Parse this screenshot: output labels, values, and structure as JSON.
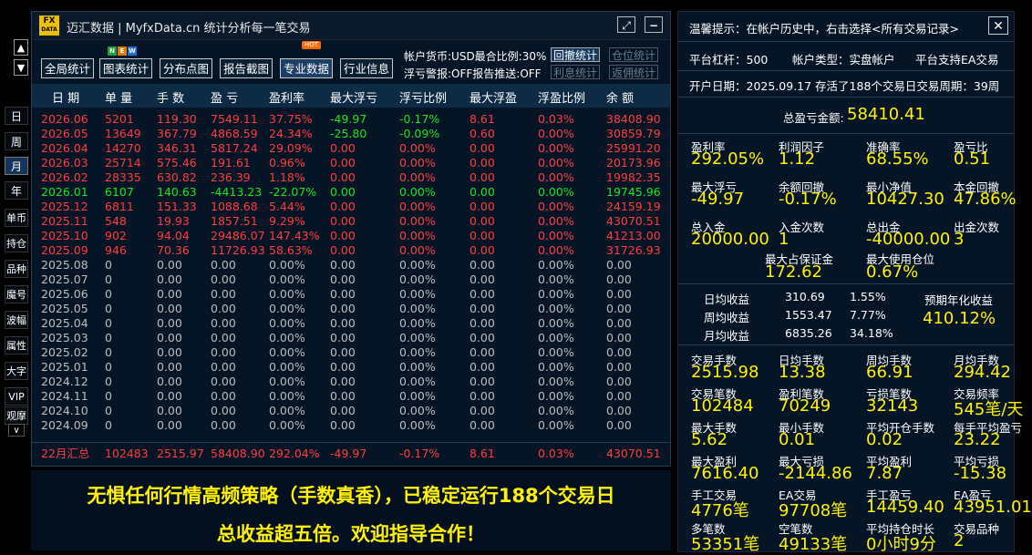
{
  "window": {
    "logo_top": "FX",
    "logo_bottom": "DATA",
    "title": "迈汇数据 | MyfxData.cn  统计分析每一笔交易",
    "minimize_glyph": "−",
    "restore_glyph": "⤢"
  },
  "toolbar": {
    "buttons": [
      "全局统计",
      "图表统计",
      "分布点图",
      "报告截图",
      "专业数据",
      "行业信息"
    ],
    "new_badge": [
      "N",
      "E",
      "W"
    ],
    "hot_badge": "HOT",
    "info1": "帐户货币:USD最合比例:30%",
    "info2": "浮亏警报:OFF报告推送:OFF",
    "btn_withdraw_stats": "回撤统计",
    "btn_position_stats": "仓位统计",
    "btn_interest_stats": "利息统计",
    "btn_commission_stats": "返佣统计",
    "up_arrow": "▲",
    "down_arrow": "▼"
  },
  "left_tabs": [
    "日",
    "周",
    "月",
    "年",
    "单币",
    "持仓",
    "品种",
    "魔号",
    "波幅",
    "属性",
    "大字",
    "VIP",
    "观摩"
  ],
  "left_tabs_more": "∨",
  "table": {
    "headers": [
      "日 期",
      "单 量",
      "手 数",
      "盈 亏",
      "盈利率",
      "最大浮亏",
      "浮亏比例",
      "最大浮盈",
      "浮盈比例",
      "余 额"
    ],
    "rows": [
      [
        "2026.06",
        "5201",
        "119.30",
        "7549.11",
        "37.75%",
        "-49.97",
        "-0.17%",
        "8.61",
        "0.03%",
        "38408.90"
      ],
      [
        "2026.05",
        "13649",
        "367.79",
        "4868.59",
        "24.34%",
        "-25.80",
        "-0.09%",
        "0.60",
        "0.00%",
        "30859.79"
      ],
      [
        "2026.04",
        "14270",
        "346.31",
        "5817.24",
        "29.09%",
        "0.00",
        "0.00%",
        "0.00",
        "0.00%",
        "25991.20"
      ],
      [
        "2026.03",
        "25714",
        "575.46",
        "191.61",
        "0.96%",
        "0.00",
        "0.00%",
        "0.00",
        "0.00%",
        "20173.96"
      ],
      [
        "2026.02",
        "28335",
        "630.82",
        "236.39",
        "1.18%",
        "0.00",
        "0.00%",
        "0.00",
        "0.00%",
        "19982.35"
      ],
      [
        "2026.01",
        "6107",
        "140.63",
        "-4413.23",
        "-22.07%",
        "0.00",
        "0.00%",
        "0.00",
        "0.00%",
        "19745.96"
      ],
      [
        "2025.12",
        "6811",
        "151.33",
        "1088.68",
        "5.44%",
        "0.00",
        "0.00%",
        "0.00",
        "0.00%",
        "24159.19"
      ],
      [
        "2025.11",
        "548",
        "19.93",
        "1857.51",
        "9.29%",
        "0.00",
        "0.00%",
        "0.00",
        "0.00%",
        "43070.51"
      ],
      [
        "2025.10",
        "902",
        "94.04",
        "29486.07",
        "147.43%",
        "0.00",
        "0.00%",
        "0.00",
        "0.00%",
        "41213.00"
      ],
      [
        "2025.09",
        "946",
        "70.36",
        "11726.93",
        "58.63%",
        "0.00",
        "0.00%",
        "0.00",
        "0.00%",
        "31726.93"
      ],
      [
        "2025.08",
        "0",
        "0.00",
        "0.00",
        "0.00%",
        "0.00",
        "0.00%",
        "0.00",
        "0.00%",
        "0.00"
      ],
      [
        "2025.07",
        "0",
        "0.00",
        "0.00",
        "0.00%",
        "0.00",
        "0.00%",
        "0.00",
        "0.00%",
        "0.00"
      ],
      [
        "2025.06",
        "0",
        "0.00",
        "0.00",
        "0.00%",
        "0.00",
        "0.00%",
        "0.00",
        "0.00%",
        "0.00"
      ],
      [
        "2025.05",
        "0",
        "0.00",
        "0.00",
        "0.00%",
        "0.00",
        "0.00%",
        "0.00",
        "0.00%",
        "0.00"
      ],
      [
        "2025.04",
        "0",
        "0.00",
        "0.00",
        "0.00%",
        "0.00",
        "0.00%",
        "0.00",
        "0.00%",
        "0.00"
      ],
      [
        "2025.03",
        "0",
        "0.00",
        "0.00",
        "0.00%",
        "0.00",
        "0.00%",
        "0.00",
        "0.00%",
        "0.00"
      ],
      [
        "2025.02",
        "0",
        "0.00",
        "0.00",
        "0.00%",
        "0.00",
        "0.00%",
        "0.00",
        "0.00%",
        "0.00"
      ],
      [
        "2025.01",
        "0",
        "0.00",
        "0.00",
        "0.00%",
        "0.00",
        "0.00%",
        "0.00",
        "0.00%",
        "0.00"
      ],
      [
        "2024.12",
        "0",
        "0.00",
        "0.00",
        "0.00%",
        "0.00",
        "0.00%",
        "0.00",
        "0.00%",
        "0.00"
      ],
      [
        "2024.11",
        "0",
        "0.00",
        "0.00",
        "0.00%",
        "0.00",
        "0.00%",
        "0.00",
        "0.00%",
        "0.00"
      ],
      [
        "2024.10",
        "0",
        "0.00",
        "0.00",
        "0.00%",
        "0.00",
        "0.00%",
        "0.00",
        "0.00%",
        "0.00"
      ],
      [
        "2024.09",
        "0",
        "0.00",
        "0.00",
        "0.00%",
        "0.00",
        "0.00%",
        "0.00",
        "0.00%",
        "0.00"
      ]
    ],
    "row_colors": [
      "red",
      "red",
      "red",
      "red",
      "red",
      "green",
      "red",
      "red",
      "red",
      "red",
      "gray",
      "gray",
      "gray",
      "gray",
      "gray",
      "gray",
      "gray",
      "gray",
      "gray",
      "gray",
      "gray",
      "gray"
    ],
    "summary": [
      "22月汇总",
      "102483",
      "2515.97",
      "58408.90",
      "292.04%",
      "-49.97",
      "-0.17%",
      "8.61",
      "0.03%",
      "43070.51"
    ]
  },
  "banner": {
    "line1": "无惧任何行情高频策略（手数真香），已稳定运行188个交易日",
    "line2": "总收益超五倍。欢迎指导合作！"
  },
  "right": {
    "tip": "温馨提示：在帐户历史中，右击选择<所有交易记录>",
    "close_glyph": "✕",
    "platform_leverage": "平台杠杆：500",
    "account_type": "帐户类型：实盘帐户",
    "ea_support": "平台支持EA交易",
    "open_info": "开户日期：2025.09.17 存活了188个交易日交易周期：39周",
    "total_pl_label": "总盈亏金额:",
    "total_pl_value": "58410.41",
    "grid1": [
      {
        "label": "盈利率",
        "value": "292.05%"
      },
      {
        "label": "利润因子",
        "value": "1.12"
      },
      {
        "label": "准确率",
        "value": "68.55%"
      },
      {
        "label": "盈亏比",
        "value": "0.51"
      },
      {
        "label": "最大浮亏",
        "value": "-49.97"
      },
      {
        "label": "余额回撤",
        "value": "-0.17%"
      },
      {
        "label": "最小净值",
        "value": "10427.30"
      },
      {
        "label": "本金回撤",
        "value": "47.86%"
      },
      {
        "label": "总入金",
        "value": "20000.00"
      },
      {
        "label": "入金次数",
        "value": "1"
      },
      {
        "label": "总出金",
        "value": "-40000.00"
      },
      {
        "label": "出金次数",
        "value": "3"
      }
    ],
    "margin": [
      {
        "label": "最大占保证金",
        "value": "172.62"
      },
      {
        "label": "最大使用仓位",
        "value": "0.67%"
      }
    ],
    "periodic": [
      {
        "label": "日均收益",
        "amount": "310.69",
        "pct": "1.55%"
      },
      {
        "label": "周均收益",
        "amount": "1553.47",
        "pct": "7.77%"
      },
      {
        "label": "月均收益",
        "amount": "6835.26",
        "pct": "34.18%"
      }
    ],
    "annual_label": "预期年化收益",
    "annual_value": "410.12%",
    "grid2": [
      {
        "label": "交易手数",
        "value": "2515.98"
      },
      {
        "label": "日均手数",
        "value": "13.38"
      },
      {
        "label": "周均手数",
        "value": "66.91"
      },
      {
        "label": "月均手数",
        "value": "294.42"
      },
      {
        "label": "交易笔数",
        "value": "102484"
      },
      {
        "label": "盈利笔数",
        "value": "70249"
      },
      {
        "label": "亏损笔数",
        "value": "32143"
      },
      {
        "label": "交易频率",
        "value": "545笔/天"
      },
      {
        "label": "最大手数",
        "value": "5.62"
      },
      {
        "label": "最小手数",
        "value": "0.01"
      },
      {
        "label": "平均开仓手数",
        "value": "0.02"
      },
      {
        "label": "每手平均盈亏",
        "value": "23.22"
      },
      {
        "label": "最大盈利",
        "value": "7616.40"
      },
      {
        "label": "最大亏损",
        "value": "-2144.86"
      },
      {
        "label": "平均盈利",
        "value": "7.87"
      },
      {
        "label": "平均亏损",
        "value": "-15.38"
      },
      {
        "label": "手工交易",
        "value": "4776笔"
      },
      {
        "label": "EA交易",
        "value": "97708笔"
      },
      {
        "label": "手工盈亏",
        "value": "14459.40"
      },
      {
        "label": "EA盈亏",
        "value": "43951.01"
      },
      {
        "label": "多笔数",
        "value": "53351笔"
      },
      {
        "label": "空笔数",
        "value": "49133笔"
      },
      {
        "label": "平均持仓时长",
        "value": "0小时9分"
      },
      {
        "label": "交易品种",
        "value": "2"
      }
    ]
  }
}
